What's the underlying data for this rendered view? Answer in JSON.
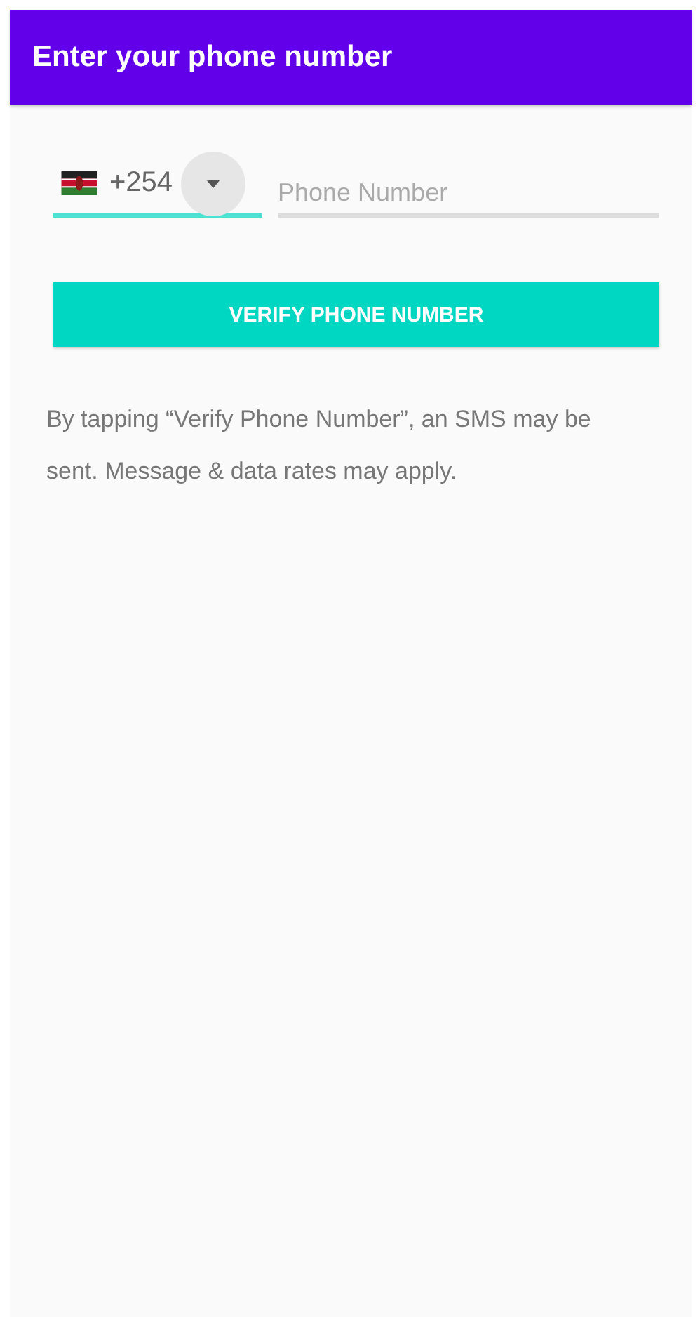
{
  "app_bar": {
    "title": "Enter your phone number"
  },
  "country_code": {
    "value": "+254",
    "focused": true
  },
  "phone_field": {
    "placeholder": "Phone Number"
  },
  "verify_button": {
    "label": "VERIFY PHONE NUMBER"
  },
  "disclaimer": "By tapping “Verify Phone Number”, an SMS may be sent. Message & data rates may apply."
}
